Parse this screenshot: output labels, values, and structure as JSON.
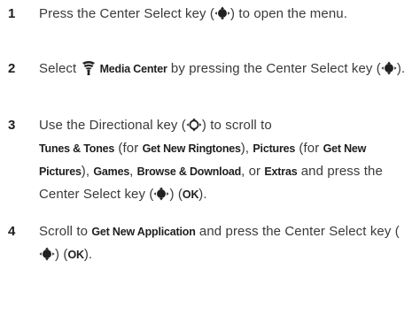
{
  "steps": [
    {
      "number": "1",
      "t1": "Press the Center Select key (",
      "t2": ") to open the menu."
    },
    {
      "number": "2",
      "t1": "Select ",
      "media_center": "Media Center",
      "t2": " by pressing the Center Select key (",
      "t3": ")."
    },
    {
      "number": "3",
      "t1": "Use the Directional key (",
      "t2": ") to scroll to ",
      "tunes": "Tunes & Tones",
      "t3": " (for ",
      "get_ringtones": "Get New Ringtones",
      "t4": "), ",
      "pictures": "Pictures",
      "t5": " (for ",
      "get_pictures": "Get New Pictures",
      "t6": "), ",
      "games": "Games",
      "t7": ", ",
      "browse": "Browse & Download",
      "t8": ", or ",
      "extras": "Extras",
      "t9": " and press the Center Select key (",
      "t10": ") (",
      "ok": "OK",
      "t11": ")."
    },
    {
      "number": "4",
      "t1": "Scroll to ",
      "get_app": "Get New Application",
      "t2": " and press the Center Select key (",
      "t3": ") (",
      "ok": "OK",
      "t4": ")."
    }
  ],
  "icons": {
    "center_select": "center-select-key-icon",
    "directional": "directional-key-icon",
    "media_center": "media-center-icon"
  },
  "colors": {
    "text": "#3a3a3a",
    "step_number": "#1e1e1e"
  }
}
